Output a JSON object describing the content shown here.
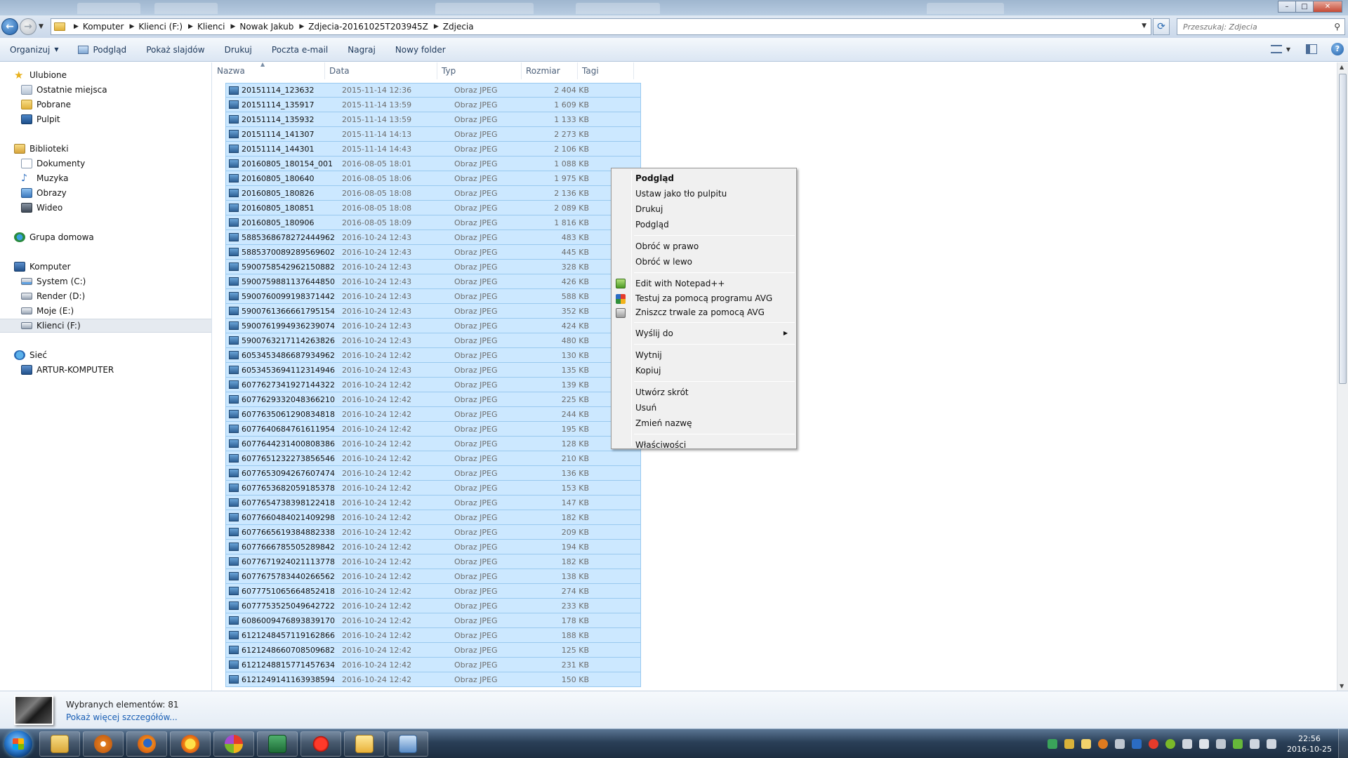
{
  "breadcrumb": [
    "Komputer",
    "Klienci (F:)",
    "Klienci",
    "Nowak Jakub",
    "Zdjecia-20161025T203945Z",
    "Zdjecia"
  ],
  "search": {
    "placeholder": "Przeszukaj: Zdjecia"
  },
  "toolbar": {
    "organize": "Organizuj",
    "preview": "Podgląd",
    "slideshow": "Pokaż slajdów",
    "print": "Drukuj",
    "email": "Poczta e-mail",
    "burn": "Nagraj",
    "new_folder": "Nowy folder"
  },
  "nav": {
    "favorites": "Ulubione",
    "recent": "Ostatnie miejsca",
    "downloads": "Pobrane",
    "desktop": "Pulpit",
    "libraries": "Biblioteki",
    "documents": "Dokumenty",
    "music": "Muzyka",
    "pictures": "Obrazy",
    "videos": "Wideo",
    "homegroup": "Grupa domowa",
    "computer": "Komputer",
    "drive_c": "System (C:)",
    "drive_d": "Render (D:)",
    "drive_e": "Moje (E:)",
    "drive_f": "Klienci (F:)",
    "network": "Sieć",
    "network_pc": "ARTUR-KOMPUTER"
  },
  "columns": {
    "name": "Nazwa",
    "date": "Data",
    "type": "Typ",
    "size": "Rozmiar",
    "tags": "Tagi"
  },
  "files": [
    [
      "20151114_123632",
      "2015-11-14 12:36",
      "Obraz JPEG",
      "2 404 KB"
    ],
    [
      "20151114_135917",
      "2015-11-14 13:59",
      "Obraz JPEG",
      "1 609 KB"
    ],
    [
      "20151114_135932",
      "2015-11-14 13:59",
      "Obraz JPEG",
      "1 133 KB"
    ],
    [
      "20151114_141307",
      "2015-11-14 14:13",
      "Obraz JPEG",
      "2 273 KB"
    ],
    [
      "20151114_144301",
      "2015-11-14 14:43",
      "Obraz JPEG",
      "2 106 KB"
    ],
    [
      "20160805_180154_001",
      "2016-08-05 18:01",
      "Obraz JPEG",
      "1 088 KB"
    ],
    [
      "20160805_180640",
      "2016-08-05 18:06",
      "Obraz JPEG",
      "1 975 KB"
    ],
    [
      "20160805_180826",
      "2016-08-05 18:08",
      "Obraz JPEG",
      "2 136 KB"
    ],
    [
      "20160805_180851",
      "2016-08-05 18:08",
      "Obraz JPEG",
      "2 089 KB"
    ],
    [
      "20160805_180906",
      "2016-08-05 18:09",
      "Obraz JPEG",
      "1 816 KB"
    ],
    [
      "5885368678272444962",
      "2016-10-24 12:43",
      "Obraz JPEG",
      "483 KB"
    ],
    [
      "5885370089289569602",
      "2016-10-24 12:43",
      "Obraz JPEG",
      "445 KB"
    ],
    [
      "5900758542962150882",
      "2016-10-24 12:43",
      "Obraz JPEG",
      "328 KB"
    ],
    [
      "5900759881137644850",
      "2016-10-24 12:43",
      "Obraz JPEG",
      "426 KB"
    ],
    [
      "5900760099198371442",
      "2016-10-24 12:43",
      "Obraz JPEG",
      "588 KB"
    ],
    [
      "5900761366661795154",
      "2016-10-24 12:43",
      "Obraz JPEG",
      "352 KB"
    ],
    [
      "5900761994936239074",
      "2016-10-24 12:43",
      "Obraz JPEG",
      "424 KB"
    ],
    [
      "5900763217114263826",
      "2016-10-24 12:43",
      "Obraz JPEG",
      "480 KB"
    ],
    [
      "6053453486687934962",
      "2016-10-24 12:42",
      "Obraz JPEG",
      "130 KB"
    ],
    [
      "6053453694112314946",
      "2016-10-24 12:43",
      "Obraz JPEG",
      "135 KB"
    ],
    [
      "6077627341927144322",
      "2016-10-24 12:42",
      "Obraz JPEG",
      "139 KB"
    ],
    [
      "6077629332048366210",
      "2016-10-24 12:42",
      "Obraz JPEG",
      "225 KB"
    ],
    [
      "6077635061290834818",
      "2016-10-24 12:42",
      "Obraz JPEG",
      "244 KB"
    ],
    [
      "6077640684761611954",
      "2016-10-24 12:42",
      "Obraz JPEG",
      "195 KB"
    ],
    [
      "6077644231400808386",
      "2016-10-24 12:42",
      "Obraz JPEG",
      "128 KB"
    ],
    [
      "6077651232273856546",
      "2016-10-24 12:42",
      "Obraz JPEG",
      "210 KB"
    ],
    [
      "6077653094267607474",
      "2016-10-24 12:42",
      "Obraz JPEG",
      "136 KB"
    ],
    [
      "6077653682059185378",
      "2016-10-24 12:42",
      "Obraz JPEG",
      "153 KB"
    ],
    [
      "6077654738398122418",
      "2016-10-24 12:42",
      "Obraz JPEG",
      "147 KB"
    ],
    [
      "6077660484021409298",
      "2016-10-24 12:42",
      "Obraz JPEG",
      "182 KB"
    ],
    [
      "6077665619384882338",
      "2016-10-24 12:42",
      "Obraz JPEG",
      "209 KB"
    ],
    [
      "6077666785505289842",
      "2016-10-24 12:42",
      "Obraz JPEG",
      "194 KB"
    ],
    [
      "6077671924021113778",
      "2016-10-24 12:42",
      "Obraz JPEG",
      "182 KB"
    ],
    [
      "6077675783440266562",
      "2016-10-24 12:42",
      "Obraz JPEG",
      "138 KB"
    ],
    [
      "6077751065664852418",
      "2016-10-24 12:42",
      "Obraz JPEG",
      "274 KB"
    ],
    [
      "6077753525049642722",
      "2016-10-24 12:42",
      "Obraz JPEG",
      "233 KB"
    ],
    [
      "6086009476893839170",
      "2016-10-24 12:42",
      "Obraz JPEG",
      "178 KB"
    ],
    [
      "6121248457119162866",
      "2016-10-24 12:42",
      "Obraz JPEG",
      "188 KB"
    ],
    [
      "6121248660708509682",
      "2016-10-24 12:42",
      "Obraz JPEG",
      "125 KB"
    ],
    [
      "6121248815771457634",
      "2016-10-24 12:42",
      "Obraz JPEG",
      "231 KB"
    ],
    [
      "6121249141163938594",
      "2016-10-24 12:42",
      "Obraz JPEG",
      "150 KB"
    ]
  ],
  "context_menu": {
    "preview_bold": "Podgląd",
    "set_wallpaper": "Ustaw jako tło pulpitu",
    "print": "Drukuj",
    "preview": "Podgląd",
    "rotate_right": "Obróć w prawo",
    "rotate_left": "Obróć w lewo",
    "notepadpp": "Edit with Notepad++",
    "avg_scan": "Testuj za pomocą programu AVG",
    "avg_shred": "Zniszcz trwale za pomocą AVG",
    "send_to": "Wyślij do",
    "cut": "Wytnij",
    "copy": "Kopiuj",
    "create_shortcut": "Utwórz skrót",
    "delete": "Usuń",
    "rename": "Zmień nazwę",
    "properties": "Właściwości"
  },
  "details": {
    "selected": "Wybranych elementów: 81",
    "more": "Pokaż więcej szczegółów..."
  },
  "clock": {
    "time": "22:56",
    "date": "2016-10-25"
  },
  "icons": {
    "taskbar": [
      "explorer-icon",
      "media-player-icon",
      "firefox-icon",
      "sun-app-icon",
      "photo-app-icon",
      "excel-icon",
      "splat-app-icon",
      "folder-mail-icon",
      "window-app-icon"
    ],
    "colors": {
      "selection": "#cce8ff",
      "selection_border": "#99c9ef",
      "link": "#1a5fb4"
    }
  }
}
